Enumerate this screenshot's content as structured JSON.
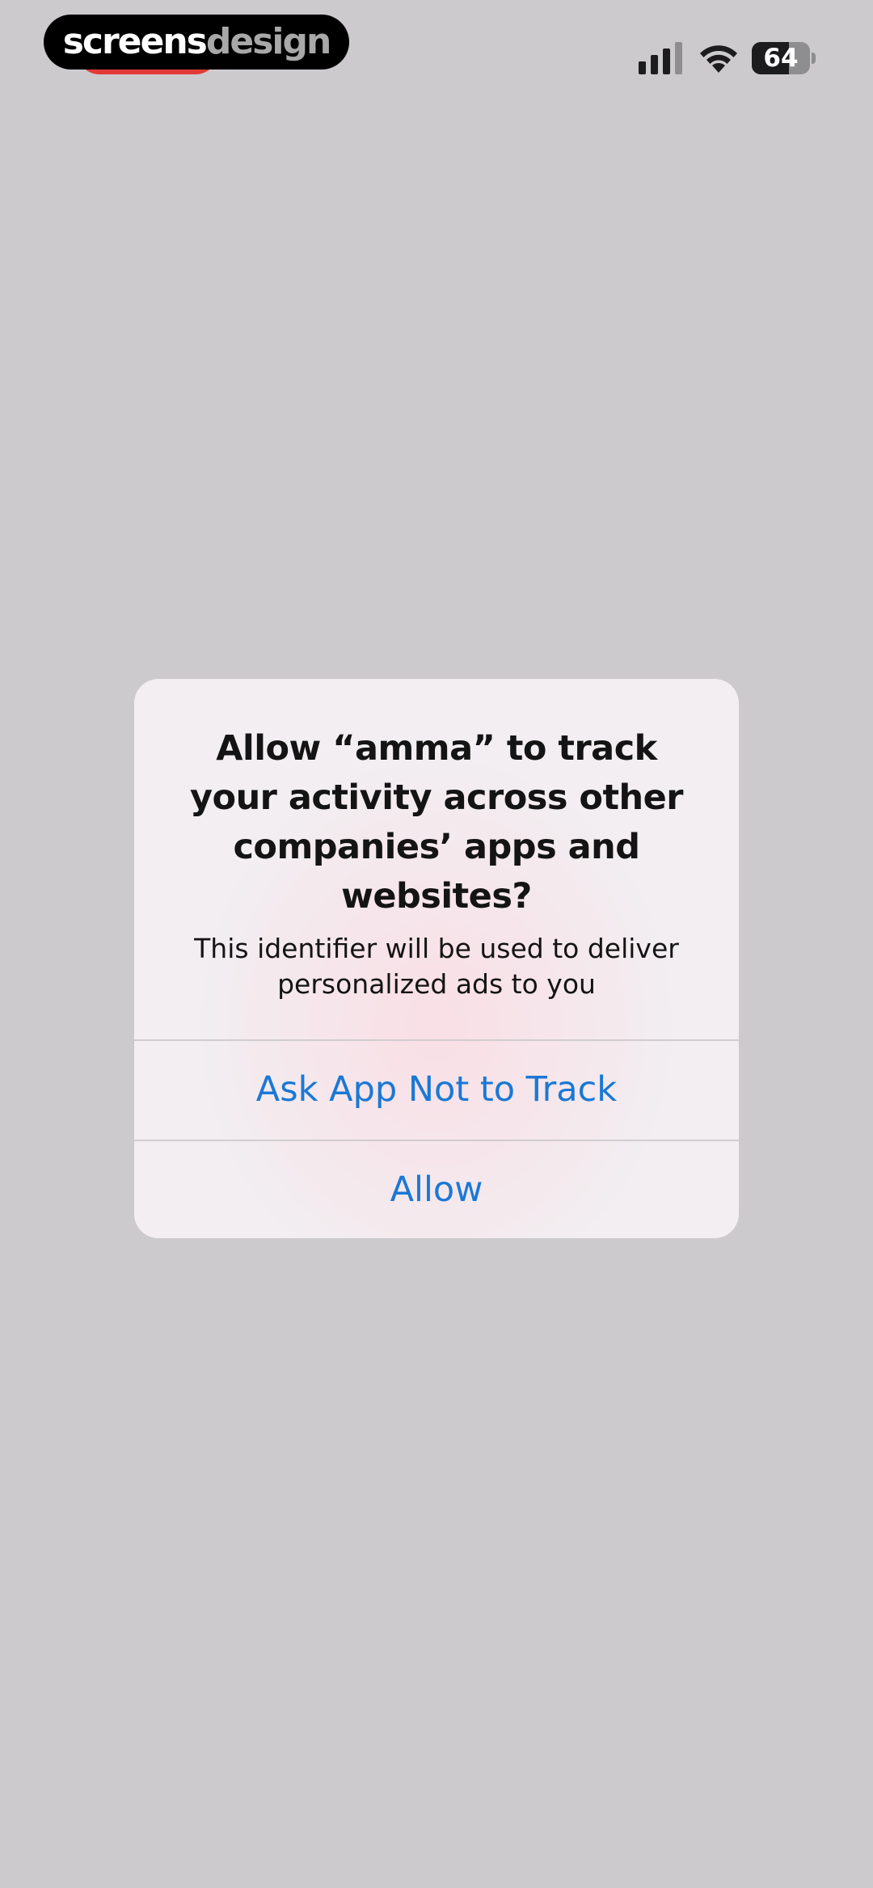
{
  "watermark": {
    "part1": "screens",
    "part2": "design"
  },
  "status_bar": {
    "battery_level": "64",
    "icons": [
      "signal-icon",
      "wifi-icon",
      "battery-icon"
    ],
    "recording_indicator_color": "#e23a36"
  },
  "alert": {
    "title": "Allow “amma” to track your activity across other companies’ apps and websites?",
    "message": "This identifier will be used to deliver personalized ads to you",
    "buttons": [
      {
        "label": "Ask App Not to Track"
      },
      {
        "label": "Allow"
      }
    ]
  },
  "colors": {
    "background": "#cccacd",
    "button_text": "#1a78d6",
    "alert_background": "#f2eef1"
  }
}
